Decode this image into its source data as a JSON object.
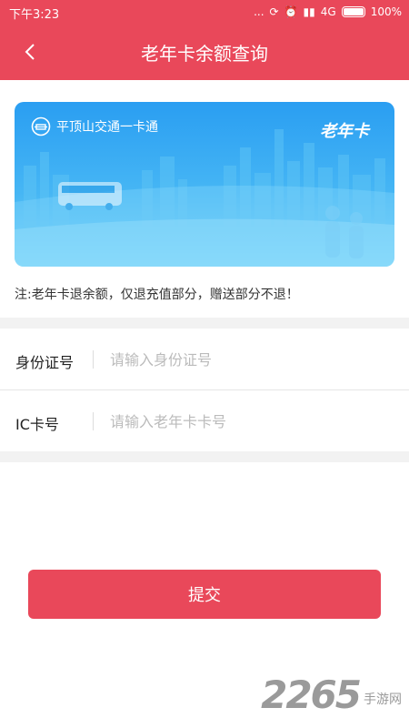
{
  "status": {
    "time": "下午3:23",
    "dots": "...",
    "network": "4G",
    "battery": "100%"
  },
  "header": {
    "title": "老年卡余额查询"
  },
  "card": {
    "brand": "平顶山交通一卡通",
    "type": "老年卡"
  },
  "note": "注:老年卡退余额，仅退充值部分，赠送部分不退！",
  "form": {
    "id_label": "身份证号",
    "id_placeholder": "请输入身份证号",
    "ic_label": "IC卡号",
    "ic_placeholder": "请输入老年卡卡号"
  },
  "submit_label": "提交",
  "watermark": {
    "number": "2265",
    "text": "手游网"
  },
  "colors": {
    "accent": "#e9485a",
    "card_top": "#2a9ef2",
    "card_bottom": "#6ed0f8"
  }
}
